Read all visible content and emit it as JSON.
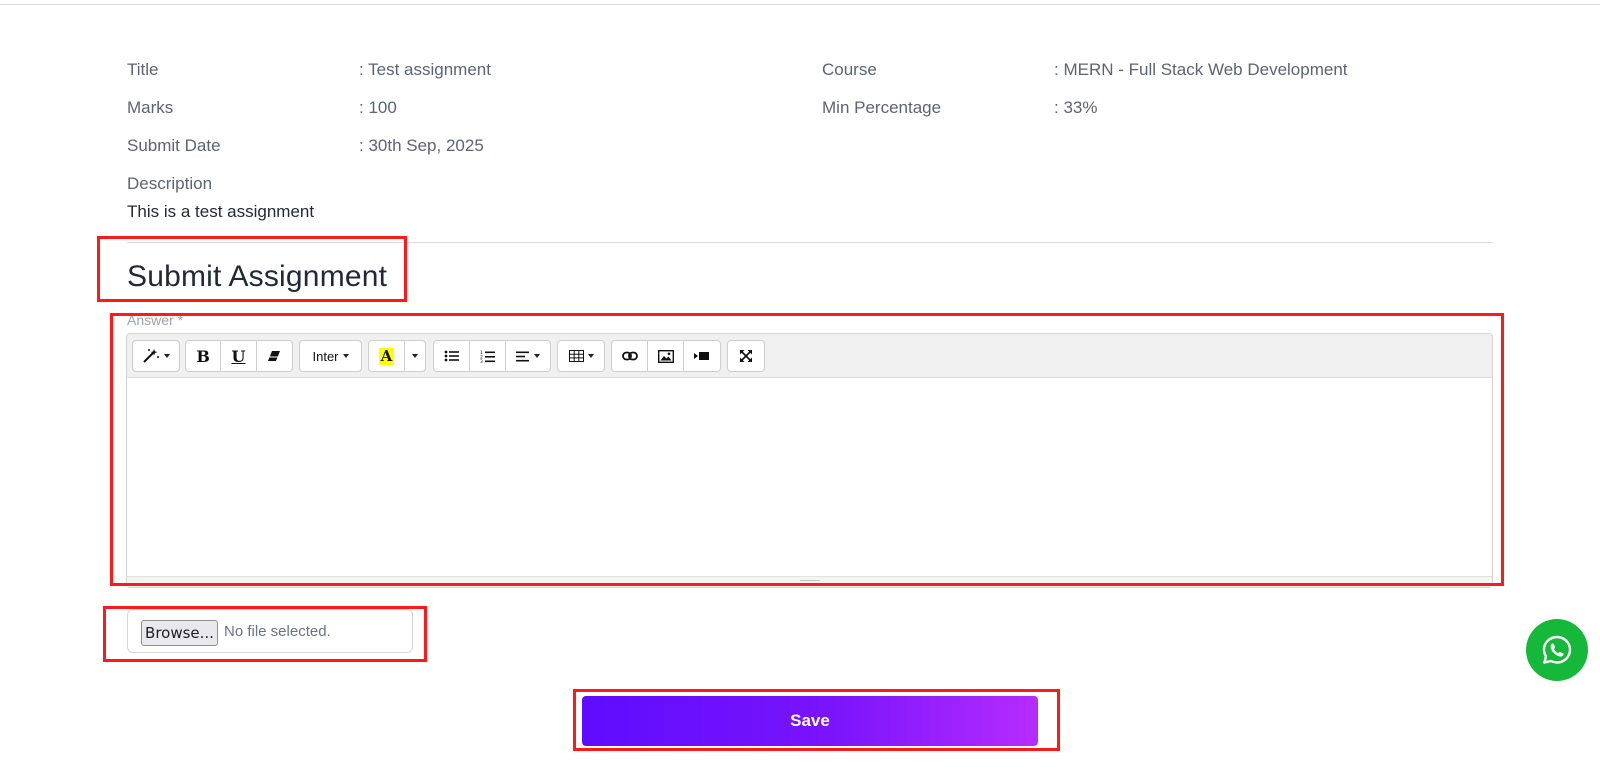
{
  "assignment": {
    "fields": [
      {
        "label": "Title",
        "value": ": Test assignment"
      },
      {
        "label": "Marks",
        "value": ": 100"
      },
      {
        "label": "Submit Date",
        "value": ": 30th Sep, 2025"
      },
      {
        "label": "Course",
        "value": ": MERN - Full Stack Web Development"
      },
      {
        "label": "Min Percentage",
        "value": ": 33%"
      }
    ],
    "description_label": "Description",
    "description_text": "This is a test assignment"
  },
  "submit": {
    "title": "Submit Assignment",
    "answer_label": "Answer *",
    "editor": {
      "font_name": "Inter",
      "highlight_letter": "A",
      "toolbar_icons": [
        "magic-wand-icon",
        "bold-icon",
        "underline-icon",
        "eraser-icon",
        "font-name-dropdown",
        "highlight-color-icon",
        "unordered-list-icon",
        "ordered-list-icon",
        "align-icon",
        "table-icon",
        "link-icon",
        "image-icon",
        "video-icon",
        "fullscreen-icon"
      ],
      "content": ""
    },
    "file": {
      "browse_label": "Browse...",
      "status": "No file selected."
    },
    "save_label": "Save"
  },
  "colors": {
    "highlight_box": "#ff1a1a",
    "save_gradient_start": "#5e0cff",
    "save_gradient_end": "#b62cff",
    "whatsapp": "#16b83a"
  }
}
